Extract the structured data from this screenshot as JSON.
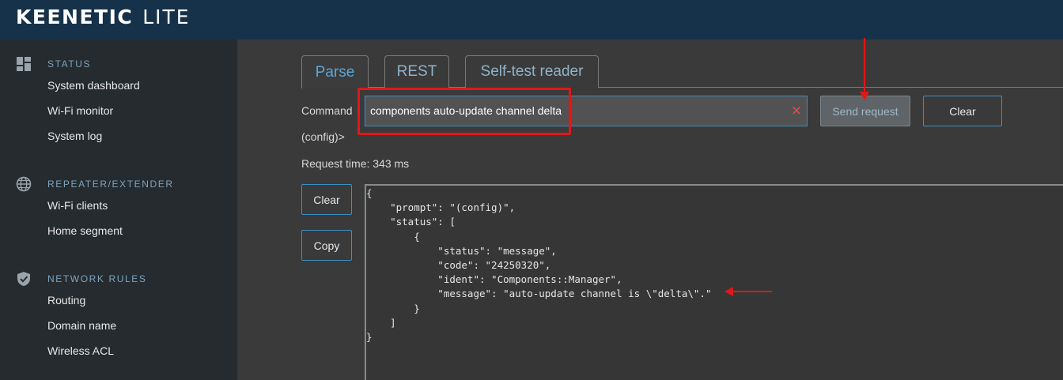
{
  "header": {
    "brand_bold": "KEENETIC",
    "brand_light": "LITE"
  },
  "sidebar": {
    "sections": [
      {
        "title": "STATUS",
        "icon": "dashboard-icon",
        "items": [
          "System dashboard",
          "Wi-Fi monitor",
          "System log"
        ]
      },
      {
        "title": "REPEATER/EXTENDER",
        "icon": "globe-icon",
        "items": [
          "Wi-Fi clients",
          "Home segment"
        ]
      },
      {
        "title": "NETWORK RULES",
        "icon": "shield-check-icon",
        "items": [
          "Routing",
          "Domain name",
          "Wireless ACL"
        ]
      }
    ]
  },
  "tabs": [
    {
      "label": "Parse",
      "active": true
    },
    {
      "label": "REST",
      "active": false
    },
    {
      "label": "Self-test reader",
      "active": false
    }
  ],
  "command": {
    "label": "Command",
    "value": "components auto-update channel delta",
    "prompt": "(config)>"
  },
  "buttons": {
    "send": "Send request",
    "clear": "Clear",
    "output_clear": "Clear",
    "copy": "Copy"
  },
  "request_time": "Request time: 343 ms",
  "output_text": "{\n    \"prompt\": \"(config)\",\n    \"status\": [\n        {\n            \"status\": \"message\",\n            \"code\": \"24250320\",\n            \"ident\": \"Components::Manager\",\n            \"message\": \"auto-update channel is \\\"delta\\\".\"\n        }\n    ]\n}",
  "colors": {
    "accent": "#3d8fc2",
    "annotation": "#e01818",
    "header_bg": "#15324a",
    "sidebar_bg": "#262b30"
  }
}
